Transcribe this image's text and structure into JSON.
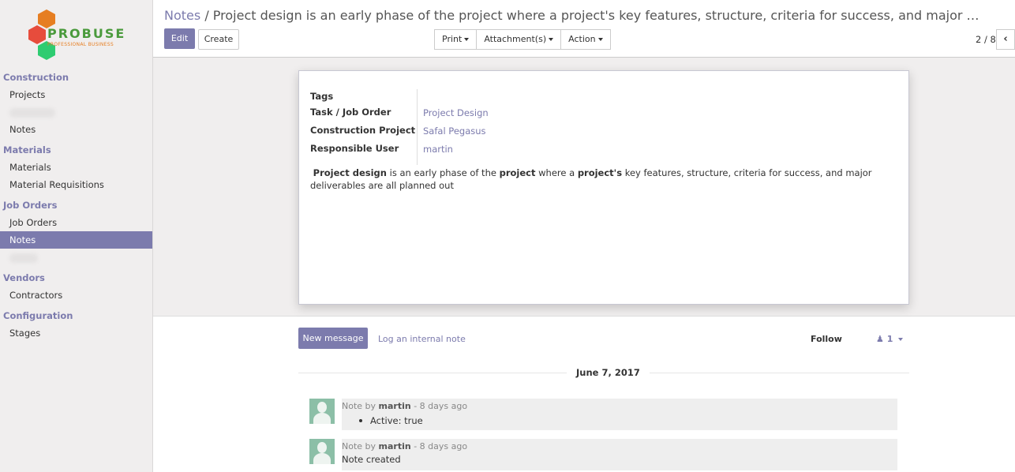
{
  "brand": {
    "name": "PROBUSE",
    "tagline": "PROFESSIONAL BUSINESS",
    "colors": {
      "accent": "#7c7bad",
      "logo_orange": "#e67e22",
      "logo_green": "#4a9a3c",
      "logo_red": "#e74c3c"
    }
  },
  "sidebar": {
    "sections": [
      {
        "title": "Construction",
        "items": [
          {
            "label": "Projects"
          },
          {
            "label": "",
            "blurred": true
          },
          {
            "label": "Notes"
          }
        ]
      },
      {
        "title": "Materials",
        "items": [
          {
            "label": "Materials"
          },
          {
            "label": "Material Requisitions"
          }
        ]
      },
      {
        "title": "Job Orders",
        "items": [
          {
            "label": "Job Orders"
          },
          {
            "label": "Notes",
            "active": true
          },
          {
            "label": "",
            "blurred": true
          }
        ]
      },
      {
        "title": "Vendors",
        "items": [
          {
            "label": "Contractors"
          }
        ]
      },
      {
        "title": "Configuration",
        "items": [
          {
            "label": "Stages"
          }
        ]
      }
    ]
  },
  "breadcrumb": {
    "parent": "Notes",
    "separator": "/",
    "current": "Project design  is an early phase of the  project  where a  project's  key features, structure, criteria for success, and major deliverables are all planned out"
  },
  "toolbar": {
    "edit": "Edit",
    "create": "Create",
    "print": "Print",
    "attachments": "Attachment(s)",
    "action": "Action",
    "pager": "2 / 8",
    "prev_icon": "‹"
  },
  "form": {
    "fields": [
      {
        "label": "Tags",
        "value": ""
      },
      {
        "label": "Task / Job Order",
        "value": "Project Design"
      },
      {
        "label": "Construction Project",
        "value": "Safal Pegasus"
      },
      {
        "label": "Responsible User",
        "value": "martin"
      }
    ],
    "memo": {
      "p1_bold": "Project design",
      "p1_text": " is an early phase of the ",
      "p2_bold": "project",
      "p2_text": " where a ",
      "p3_bold": "project's",
      "p3_text": " key features, structure, criteria for success, and major deliverables are all planned out"
    }
  },
  "chatter": {
    "new_message": "New message",
    "log_note": "Log an internal note",
    "follow": "Follow",
    "followers_count": "1",
    "date": "June 7, 2017",
    "messages": [
      {
        "prefix": "Note by",
        "author": "martin",
        "time": "- 8 days ago",
        "text": "Active: true",
        "bullet": true
      },
      {
        "prefix": "Note by",
        "author": "martin",
        "time": "- 8 days ago",
        "text": "Note created",
        "bullet": false
      }
    ]
  }
}
